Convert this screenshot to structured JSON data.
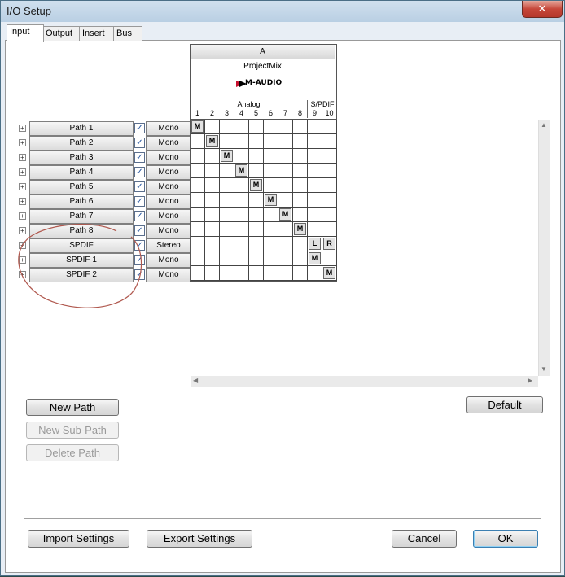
{
  "window": {
    "title": "I/O Setup",
    "close_glyph": "✕"
  },
  "tabs": [
    {
      "label": "Input",
      "active": true
    },
    {
      "label": "Output",
      "active": false
    },
    {
      "label": "Insert",
      "active": false
    },
    {
      "label": "Bus",
      "active": false
    }
  ],
  "device": {
    "group": "A",
    "name": "ProjectMix",
    "brand": "M-AUDIO",
    "groups": [
      {
        "label": "Analog"
      },
      {
        "label": "S/PDIF"
      }
    ],
    "channels": [
      "1",
      "2",
      "3",
      "4",
      "5",
      "6",
      "7",
      "8",
      "9",
      "10"
    ]
  },
  "paths": [
    {
      "label": "Path 1",
      "format": "Mono",
      "checked": true,
      "marks": [
        {
          "ch": 1,
          "t": "M"
        }
      ]
    },
    {
      "label": "Path 2",
      "format": "Mono",
      "checked": true,
      "marks": [
        {
          "ch": 2,
          "t": "M"
        }
      ]
    },
    {
      "label": "Path 3",
      "format": "Mono",
      "checked": true,
      "marks": [
        {
          "ch": 3,
          "t": "M"
        }
      ]
    },
    {
      "label": "Path 4",
      "format": "Mono",
      "checked": true,
      "marks": [
        {
          "ch": 4,
          "t": "M"
        }
      ]
    },
    {
      "label": "Path 5",
      "format": "Mono",
      "checked": true,
      "marks": [
        {
          "ch": 5,
          "t": "M"
        }
      ]
    },
    {
      "label": "Path 6",
      "format": "Mono",
      "checked": true,
      "marks": [
        {
          "ch": 6,
          "t": "M"
        }
      ]
    },
    {
      "label": "Path 7",
      "format": "Mono",
      "checked": true,
      "marks": [
        {
          "ch": 7,
          "t": "M"
        }
      ]
    },
    {
      "label": "Path 8",
      "format": "Mono",
      "checked": true,
      "marks": [
        {
          "ch": 8,
          "t": "M"
        }
      ]
    },
    {
      "label": "SPDIF",
      "format": "Stereo",
      "checked": true,
      "marks": [
        {
          "ch": 9,
          "t": "L"
        },
        {
          "ch": 10,
          "t": "R"
        }
      ]
    },
    {
      "label": "SPDIF 1",
      "format": "Mono",
      "checked": true,
      "marks": [
        {
          "ch": 9,
          "t": "M"
        }
      ]
    },
    {
      "label": "SPDIF 2",
      "format": "Mono",
      "checked": true,
      "marks": [
        {
          "ch": 10,
          "t": "M"
        }
      ]
    }
  ],
  "check_glyph": "✓",
  "expand_glyph": "+",
  "buttons": {
    "new_path": "New Path",
    "new_sub_path": "New Sub-Path",
    "delete_path": "Delete Path",
    "default": "Default",
    "import": "Import Settings",
    "export": "Export Settings",
    "cancel": "Cancel",
    "ok": "OK"
  },
  "colors": {
    "annotation": "#b0584e",
    "brand_red": "#c8102e"
  }
}
